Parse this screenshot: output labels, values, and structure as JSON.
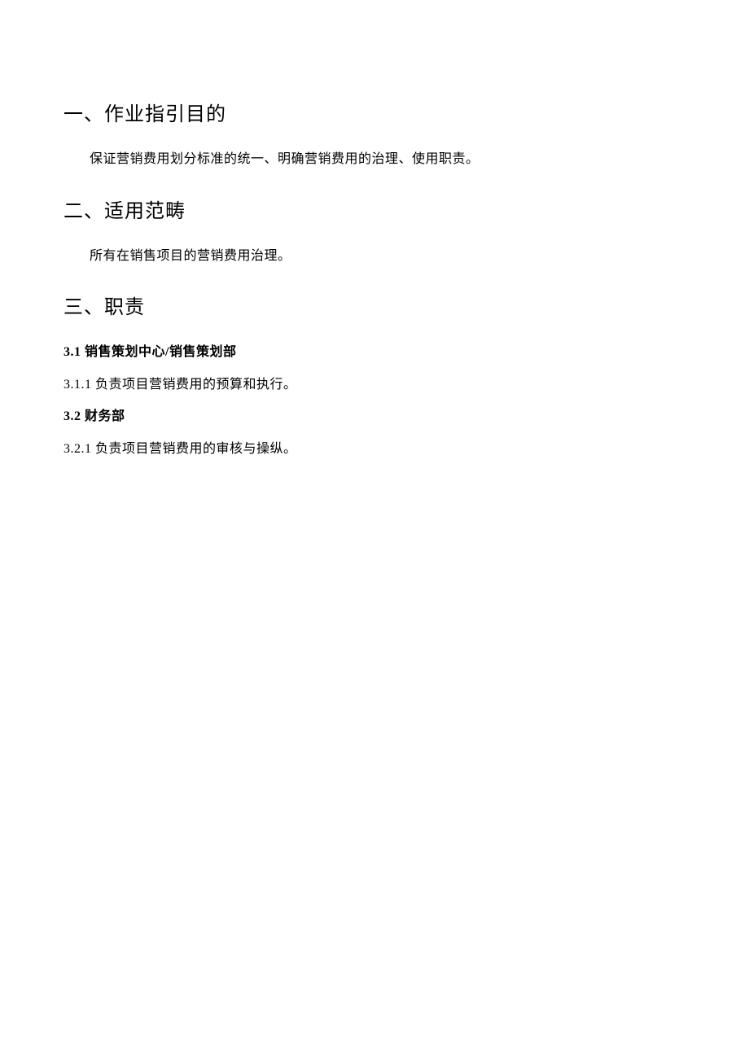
{
  "section1": {
    "heading": "一、作业指引目的",
    "body": "保证营销费用划分标准的统一、明确营销费用的治理、使用职责。"
  },
  "section2": {
    "heading": "二、适用范畴",
    "body": "所有在销售项目的营销费用治理。"
  },
  "section3": {
    "heading": "三、职责",
    "s31": {
      "num": "3.1",
      "title": " 销售策划中心/销售策划部"
    },
    "s311": {
      "num": "3.1.1",
      "text": " 负责项目营销费用的预算和执行。"
    },
    "s32": {
      "num": "3.2",
      "title": " 财务部"
    },
    "s321": {
      "num": "3.2.1",
      "text": " 负责项目营销费用的审核与操纵。"
    }
  }
}
